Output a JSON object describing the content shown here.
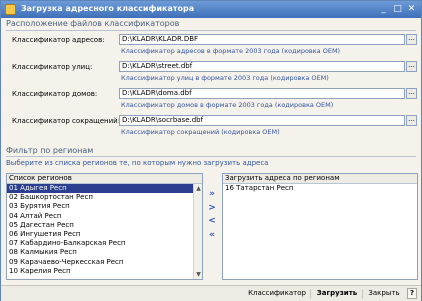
{
  "window": {
    "title": "Загрузка адресного классификатора",
    "min_glyph": "_",
    "max_glyph": "□",
    "close_glyph": "✕"
  },
  "files": {
    "section_title": "Расположение файлов классификаторов",
    "rows": [
      {
        "label": "Классификатор адресов:",
        "value": "D:\\KLADR\\KLADR.DBF",
        "desc": "Классификатор адресов в формате  2003 года  (кодировка OEM)"
      },
      {
        "label": "Классификатор улиц:",
        "value": "D:\\KLADR\\street.dbf",
        "desc": "Классификатор улиц в формате  2003 года  (кодировка OEM)"
      },
      {
        "label": "Классификатор домов:",
        "value": "D:\\KLADR\\doma.dbf",
        "desc": "Классификатор домов в формате  2003 года  (кодировка OEM)"
      },
      {
        "label": "Классификатор сокращений:",
        "value": "D:\\KLADR\\socrbase.dbf",
        "desc": "Классификатор сокращений (кодировка OEM)"
      }
    ],
    "browse_label": "..."
  },
  "filter": {
    "section_title": "Фильтр по регионам",
    "hint": "Выберите из списка регионов те, по которым нужно загрузить адреса",
    "left_header": "Список регионов",
    "left_items": [
      "01 Адыгея Респ",
      "02 Башкортостан Респ",
      "03 Бурятия Респ",
      "04 Алтай Респ",
      "05 Дагестан Респ",
      "06 Ингушетия Респ",
      "07 Кабардино-Балкарская Респ",
      "08 Калмыкия Респ",
      "09 Карачаево-Черкесская Респ",
      "10 Карелия Респ"
    ],
    "selected_index": 0,
    "right_header": "Загрузить адреса по регионам",
    "right_items": [
      "16 Татарстан Респ"
    ],
    "move_all_right": "»",
    "move_right": ">",
    "move_left": "<",
    "move_all_left": "«",
    "scroll_up": "▲",
    "scroll_down": "▼"
  },
  "bottom": {
    "classifier_label": "Классификатор",
    "load_label": "Загрузить",
    "close_label": "Закрыть",
    "help_label": "?"
  }
}
